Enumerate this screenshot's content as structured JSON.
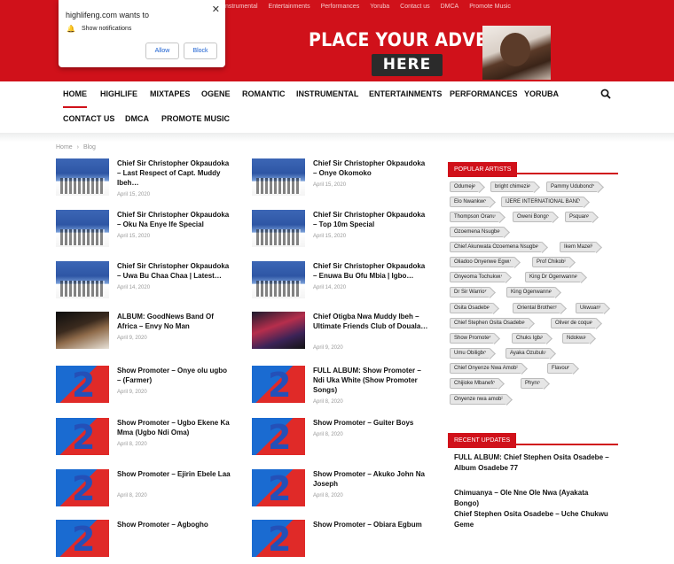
{
  "top_nav": [
    "Instrumental",
    "Entertainments",
    "Performances",
    "Yoruba",
    "Contact us",
    "DMCA",
    "Promote Music"
  ],
  "advert": {
    "title": "PLACE YOUR ADVERT",
    "here": "HERE"
  },
  "notification": {
    "site": "highlifeng.com wants to",
    "message": "Show notifications",
    "allow": "Allow",
    "block": "Block"
  },
  "main_nav": [
    "HOME",
    "HIGHLIFE",
    "MIXTAPES",
    "OGENE",
    "ROMANTIC",
    "INSTRUMENTAL",
    "ENTERTAINMENTS",
    "PERFORMANCES",
    "YORUBA",
    "CONTACT US",
    "DMCA",
    "PROMOTE MUSIC"
  ],
  "breadcrumb": {
    "home": "Home",
    "sep": "›",
    "current": "Blog"
  },
  "posts_left": [
    {
      "title": "Chief Sir Christopher Okpaudoka – Last Respect of Capt. Muddy Ibeh…",
      "date": "April 15, 2020",
      "thumb": "blue"
    },
    {
      "title": "Chief Sir Christopher Okpaudoka – Oku Na Enye Ife Special",
      "date": "April 15, 2020",
      "thumb": "blue"
    },
    {
      "title": "Chief Sir Christopher Okpaudoka – Uwa Bu Chaa Chaa | Latest…",
      "date": "April 14, 2020",
      "thumb": "blue"
    },
    {
      "title": "ALBUM: GoodNews Band Of Africa – Envy No Man",
      "date": "April 9, 2020",
      "thumb": "album"
    },
    {
      "title": "Show Promoter – Onye olu ugbo – (Farmer)",
      "date": "April 9, 2020",
      "thumb": "promo"
    },
    {
      "title": "Show Promoter – Ugbo Ekene Ka Mma (Ugbo Ndi Oma)",
      "date": "April 8, 2020",
      "thumb": "promo"
    },
    {
      "title": "Show Promoter – Ejirin Ebele Laa",
      "date": "April 8, 2020",
      "thumb": "promo"
    },
    {
      "title": "Show Promoter – Agbogho",
      "date": "",
      "thumb": "promo"
    }
  ],
  "posts_right": [
    {
      "title": "Chief Sir Christopher Okpaudoka – Onye Okomoko",
      "date": "April 15, 2020",
      "thumb": "blue"
    },
    {
      "title": "Chief Sir Christopher Okpaudoka – Top 10m Special",
      "date": "April 15, 2020",
      "thumb": "blue"
    },
    {
      "title": "Chief Sir Christopher Okpaudoka – Enuwa Bu Ofu Mbia | Igbo…",
      "date": "April 14, 2020",
      "thumb": "blue"
    },
    {
      "title": "Chief Otigba Nwa Muddy Ibeh – Ultimate Friends Club of Douala…",
      "date": "April 9, 2020",
      "thumb": "poster"
    },
    {
      "title": "FULL ALBUM: Show Promoter – Ndi Uka White (Show Promoter Songs)",
      "date": "April 8, 2020",
      "thumb": "promo"
    },
    {
      "title": "Show Promoter – Guiter Boys",
      "date": "April 8, 2020",
      "thumb": "promo"
    },
    {
      "title": "Show Promoter – Akuko John Na Joseph",
      "date": "April 8, 2020",
      "thumb": "promo"
    },
    {
      "title": "Show Promoter – Obiara Egbum",
      "date": "",
      "thumb": "promo"
    }
  ],
  "popular_artists": {
    "heading": "POPULAR ARTISTS",
    "tags": [
      "Odumeje",
      "bright chimezie",
      "Pammy Udubonch",
      "Elo Nwankwo",
      "IJERE INTERNATIONAL BAND",
      "Thompson Oranu",
      "Oweni Bongo",
      "Psquare",
      "Ozoemena Nsugbe",
      "Chief Akunwata Ozoemena Nsugbe",
      "Ikem Mazeli",
      "Oliadoo Onyenwe Egwu",
      "Prof Chikobi",
      "Onyeoma Tochukwu",
      "King Dr Ogenwanne",
      "Dr Sir Warrior",
      "King Ogenwanne",
      "Osita Osadebe",
      "Oriental Brothers",
      "Ukwuani",
      "Chief Stephen Osita Osadebe",
      "Oliver de coque",
      "Show Promoter",
      "Chuks Igba",
      "Ndokwa",
      "Umu Obiligbo",
      "Ayaka Ozubulu",
      "Chief Onyenze Nwa Amobi",
      "Flavour",
      "Chijioke Mbanefo",
      "Phyno",
      "Onyenze nwa amobi"
    ]
  },
  "recent_updates": {
    "heading": "RECENT UPDATES",
    "items": [
      "FULL ALBUM: Chief Stephen Osita Osadebe – Album Osadebe 77",
      "Chimuanya – Ole Nne Ole Nwa (Ayakata Bongo)",
      "Chief Stephen Osita Osadebe – Uche Chukwu Geme"
    ]
  },
  "icons": {
    "search": "search-icon",
    "bell": "bell-icon",
    "close": "close-icon"
  },
  "colors": {
    "brand": "#d0111a",
    "link_blue": "#1a5fd0"
  }
}
